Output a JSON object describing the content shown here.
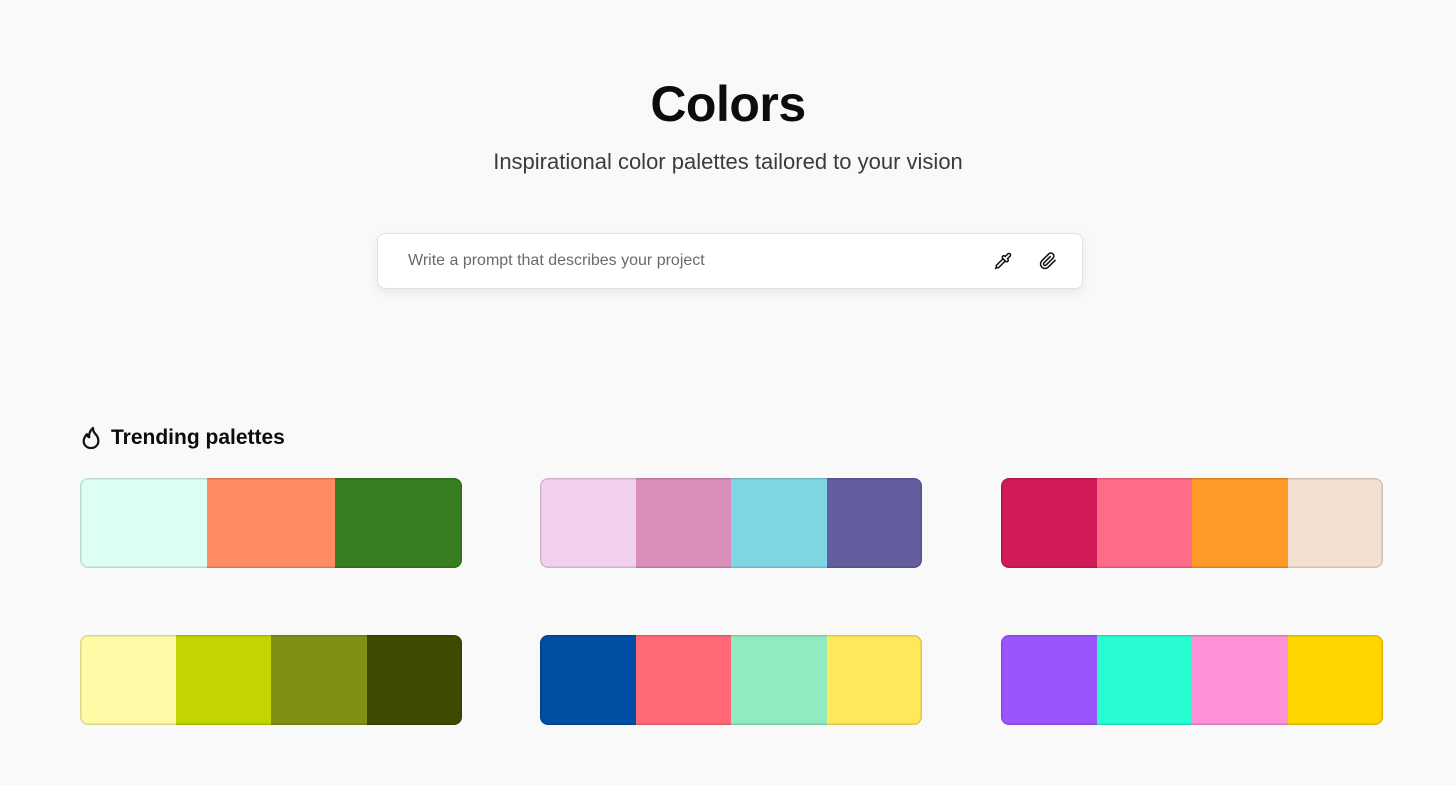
{
  "header": {
    "title": "Colors",
    "subtitle": "Inspirational color palettes tailored to your vision"
  },
  "prompt": {
    "placeholder": "Write a prompt that describes your project",
    "value": "",
    "icons": [
      "eyedropper-icon",
      "paperclip-icon"
    ]
  },
  "trending": {
    "icon": "flame-icon",
    "title": "Trending palettes",
    "palettes": [
      {
        "colors": [
          "#dcfef5",
          "#ff8c62",
          "#377f21"
        ]
      },
      {
        "colors": [
          "#f2d1ef",
          "#dc8eba",
          "#7ed7e3",
          "#645ea1"
        ]
      },
      {
        "colors": [
          "#d11a57",
          "#ff6b89",
          "#ff9928",
          "#f3e0d1"
        ]
      },
      {
        "colors": [
          "#fffaa6",
          "#c3d500",
          "#819015",
          "#3d4b02"
        ]
      },
      {
        "colors": [
          "#004ea3",
          "#ff6874",
          "#90ebc0",
          "#ffe85a"
        ]
      },
      {
        "colors": [
          "#9a55ff",
          "#27fdd1",
          "#ff91d8",
          "#ffd600"
        ]
      }
    ]
  }
}
